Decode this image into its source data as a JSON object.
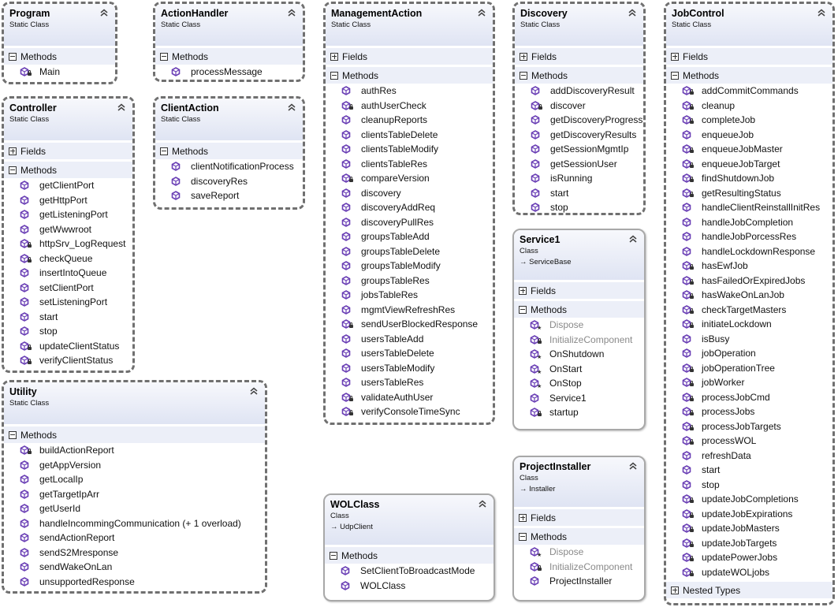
{
  "colors": {
    "method_icon": "#6a3fb5",
    "header_gradient_end": "#dfe4f3",
    "section_bg": "#eceff8"
  },
  "classes": [
    {
      "id": "program",
      "name": "Program",
      "kind": "Static Class",
      "static": true,
      "sections": [
        {
          "label": "Methods",
          "expanded": true,
          "items": [
            {
              "name": "Main",
              "access": "private"
            }
          ]
        }
      ]
    },
    {
      "id": "controller",
      "name": "Controller",
      "kind": "Static Class",
      "static": true,
      "sections": [
        {
          "label": "Fields",
          "expanded": false,
          "items": []
        },
        {
          "label": "Methods",
          "expanded": true,
          "items": [
            {
              "name": "getClientPort",
              "access": "public"
            },
            {
              "name": "getHttpPort",
              "access": "public"
            },
            {
              "name": "getListeningPort",
              "access": "public"
            },
            {
              "name": "getWwwroot",
              "access": "public"
            },
            {
              "name": "httpSrv_LogRequest",
              "access": "private"
            },
            {
              "name": "checkQueue",
              "access": "private"
            },
            {
              "name": "insertIntoQueue",
              "access": "public"
            },
            {
              "name": "setClientPort",
              "access": "public"
            },
            {
              "name": "setListeningPort",
              "access": "public"
            },
            {
              "name": "start",
              "access": "public"
            },
            {
              "name": "stop",
              "access": "public"
            },
            {
              "name": "updateClientStatus",
              "access": "private"
            },
            {
              "name": "verifyClientStatus",
              "access": "private"
            }
          ]
        }
      ]
    },
    {
      "id": "utility",
      "name": "Utility",
      "kind": "Static Class",
      "static": true,
      "sections": [
        {
          "label": "Methods",
          "expanded": true,
          "items": [
            {
              "name": "buildActionReport",
              "access": "private"
            },
            {
              "name": "getAppVersion",
              "access": "public"
            },
            {
              "name": "getLocalIp",
              "access": "public"
            },
            {
              "name": "getTargetIpArr",
              "access": "public"
            },
            {
              "name": "getUserId",
              "access": "public"
            },
            {
              "name": "handleIncommingCommunication (+ 1 overload)",
              "access": "public"
            },
            {
              "name": "sendActionReport",
              "access": "public"
            },
            {
              "name": "sendS2Mresponse",
              "access": "public"
            },
            {
              "name": "sendWakeOnLan",
              "access": "public"
            },
            {
              "name": "unsupportedResponse",
              "access": "public"
            }
          ]
        }
      ]
    },
    {
      "id": "actionhandler",
      "name": "ActionHandler",
      "kind": "Static Class",
      "static": true,
      "sections": [
        {
          "label": "Methods",
          "expanded": true,
          "items": [
            {
              "name": "processMessage",
              "access": "public"
            }
          ]
        }
      ]
    },
    {
      "id": "clientaction",
      "name": "ClientAction",
      "kind": "Static Class",
      "static": true,
      "sections": [
        {
          "label": "Methods",
          "expanded": true,
          "items": [
            {
              "name": "clientNotificationProcess",
              "access": "public"
            },
            {
              "name": "discoveryRes",
              "access": "public"
            },
            {
              "name": "saveReport",
              "access": "public"
            }
          ]
        }
      ]
    },
    {
      "id": "managementaction",
      "name": "ManagementAction",
      "kind": "Static Class",
      "static": true,
      "sections": [
        {
          "label": "Fields",
          "expanded": false,
          "items": []
        },
        {
          "label": "Methods",
          "expanded": true,
          "items": [
            {
              "name": "authRes",
              "access": "public"
            },
            {
              "name": "authUserCheck",
              "access": "private"
            },
            {
              "name": "cleanupReports",
              "access": "public"
            },
            {
              "name": "clientsTableDelete",
              "access": "public"
            },
            {
              "name": "clientsTableModify",
              "access": "public"
            },
            {
              "name": "clientsTableRes",
              "access": "public"
            },
            {
              "name": "compareVersion",
              "access": "private"
            },
            {
              "name": "discovery",
              "access": "public"
            },
            {
              "name": "discoveryAddReq",
              "access": "public"
            },
            {
              "name": "discoveryPullRes",
              "access": "public"
            },
            {
              "name": "groupsTableAdd",
              "access": "public"
            },
            {
              "name": "groupsTableDelete",
              "access": "public"
            },
            {
              "name": "groupsTableModify",
              "access": "public"
            },
            {
              "name": "groupsTableRes",
              "access": "public"
            },
            {
              "name": "jobsTableRes",
              "access": "public"
            },
            {
              "name": "mgmtViewRefreshRes",
              "access": "public"
            },
            {
              "name": "sendUserBlockedResponse",
              "access": "private"
            },
            {
              "name": "usersTableAdd",
              "access": "public"
            },
            {
              "name": "usersTableDelete",
              "access": "public"
            },
            {
              "name": "usersTableModify",
              "access": "public"
            },
            {
              "name": "usersTableRes",
              "access": "public"
            },
            {
              "name": "validateAuthUser",
              "access": "private"
            },
            {
              "name": "verifyConsoleTimeSync",
              "access": "private"
            }
          ]
        }
      ]
    },
    {
      "id": "discovery",
      "name": "Discovery",
      "kind": "Static Class",
      "static": true,
      "sections": [
        {
          "label": "Fields",
          "expanded": false,
          "items": []
        },
        {
          "label": "Methods",
          "expanded": true,
          "items": [
            {
              "name": "addDiscoveryResult",
              "access": "public"
            },
            {
              "name": "discover",
              "access": "private"
            },
            {
              "name": "getDiscoveryProgress",
              "access": "public"
            },
            {
              "name": "getDiscoveryResults",
              "access": "public"
            },
            {
              "name": "getSessionMgmtIp",
              "access": "public"
            },
            {
              "name": "getSessionUser",
              "access": "public"
            },
            {
              "name": "isRunning",
              "access": "public"
            },
            {
              "name": "start",
              "access": "public"
            },
            {
              "name": "stop",
              "access": "public"
            }
          ]
        }
      ]
    },
    {
      "id": "service1",
      "name": "Service1",
      "kind": "Class",
      "base": "ServiceBase",
      "static": false,
      "sections": [
        {
          "label": "Fields",
          "expanded": false,
          "items": []
        },
        {
          "label": "Methods",
          "expanded": true,
          "items": [
            {
              "name": "Dispose",
              "access": "protected",
              "dimmed": true
            },
            {
              "name": "InitializeComponent",
              "access": "private",
              "dimmed": true
            },
            {
              "name": "OnShutdown",
              "access": "protected"
            },
            {
              "name": "OnStart",
              "access": "protected"
            },
            {
              "name": "OnStop",
              "access": "protected"
            },
            {
              "name": "Service1",
              "access": "public"
            },
            {
              "name": "startup",
              "access": "private"
            }
          ]
        }
      ]
    },
    {
      "id": "wolclass",
      "name": "WOLClass",
      "kind": "Class",
      "base": "UdpClient",
      "static": false,
      "sections": [
        {
          "label": "Methods",
          "expanded": true,
          "items": [
            {
              "name": "SetClientToBroadcastMode",
              "access": "public"
            },
            {
              "name": "WOLClass",
              "access": "public"
            }
          ]
        }
      ]
    },
    {
      "id": "projectinstaller",
      "name": "ProjectInstaller",
      "kind": "Class",
      "base": "Installer",
      "static": false,
      "sections": [
        {
          "label": "Fields",
          "expanded": false,
          "items": []
        },
        {
          "label": "Methods",
          "expanded": true,
          "items": [
            {
              "name": "Dispose",
              "access": "protected",
              "dimmed": true
            },
            {
              "name": "InitializeComponent",
              "access": "private",
              "dimmed": true
            },
            {
              "name": "ProjectInstaller",
              "access": "public"
            }
          ]
        }
      ]
    },
    {
      "id": "jobcontrol",
      "name": "JobControl",
      "kind": "Static Class",
      "static": true,
      "sections": [
        {
          "label": "Fields",
          "expanded": false,
          "items": []
        },
        {
          "label": "Methods",
          "expanded": true,
          "items": [
            {
              "name": "addCommitCommands",
              "access": "private"
            },
            {
              "name": "cleanup",
              "access": "private"
            },
            {
              "name": "completeJob",
              "access": "private"
            },
            {
              "name": "enqueueJob",
              "access": "public"
            },
            {
              "name": "enqueueJobMaster",
              "access": "private"
            },
            {
              "name": "enqueueJobTarget",
              "access": "private"
            },
            {
              "name": "findShutdownJob",
              "access": "private"
            },
            {
              "name": "getResultingStatus",
              "access": "private"
            },
            {
              "name": "handleClientReinstallInitRes",
              "access": "public"
            },
            {
              "name": "handleJobCompletion",
              "access": "public"
            },
            {
              "name": "handleJobPorcessRes",
              "access": "public"
            },
            {
              "name": "handleLockdownResponse",
              "access": "public"
            },
            {
              "name": "hasEwfJob",
              "access": "private"
            },
            {
              "name": "hasFailedOrExpiredJobs",
              "access": "private"
            },
            {
              "name": "hasWakeOnLanJob",
              "access": "private"
            },
            {
              "name": "checkTargetMasters",
              "access": "private"
            },
            {
              "name": "initiateLockdown",
              "access": "private"
            },
            {
              "name": "isBusy",
              "access": "public"
            },
            {
              "name": "jobOperation",
              "access": "public"
            },
            {
              "name": "jobOperationTree",
              "access": "private"
            },
            {
              "name": "jobWorker",
              "access": "private"
            },
            {
              "name": "processJobCmd",
              "access": "private"
            },
            {
              "name": "processJobs",
              "access": "private"
            },
            {
              "name": "processJobTargets",
              "access": "private"
            },
            {
              "name": "processWOL",
              "access": "private"
            },
            {
              "name": "refreshData",
              "access": "public"
            },
            {
              "name": "start",
              "access": "public"
            },
            {
              "name": "stop",
              "access": "public"
            },
            {
              "name": "updateJobCompletions",
              "access": "private"
            },
            {
              "name": "updateJobExpirations",
              "access": "private"
            },
            {
              "name": "updateJobMasters",
              "access": "private"
            },
            {
              "name": "updateJobTargets",
              "access": "private"
            },
            {
              "name": "updatePowerJobs",
              "access": "private"
            },
            {
              "name": "updateWOLjobs",
              "access": "private"
            }
          ]
        },
        {
          "label": "Nested Types",
          "expanded": false,
          "items": []
        }
      ]
    }
  ]
}
